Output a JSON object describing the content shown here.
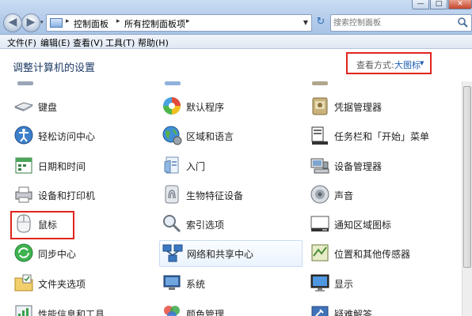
{
  "window": {
    "minimize_glyph": "—",
    "maximize_glyph": "□",
    "close_glyph": "✕"
  },
  "nav": {
    "back_glyph": "◀",
    "forward_glyph": "▶"
  },
  "address": {
    "crumbs": [
      "控制面板",
      "所有控制面板项"
    ],
    "refresh_glyph": "↻"
  },
  "search": {
    "placeholder": "搜索控制面板"
  },
  "menu": {
    "items": [
      "文件(F)",
      "编辑(E)",
      "查看(V)",
      "工具(T)",
      "帮助(H)"
    ]
  },
  "header": {
    "title": "调整计算机的设置",
    "view_by_label": "查看方式:",
    "view_by_value": "大图标"
  },
  "items": [
    {
      "label": "键盘",
      "icon": "keyboard-icon"
    },
    {
      "label": "默认程序",
      "icon": "default-programs-icon"
    },
    {
      "label": "凭据管理器",
      "icon": "credential-manager-icon"
    },
    {
      "label": "轻松访问中心",
      "icon": "ease-of-access-icon"
    },
    {
      "label": "区域和语言",
      "icon": "region-language-icon"
    },
    {
      "label": "任务栏和「开始」菜单",
      "icon": "taskbar-start-menu-icon"
    },
    {
      "label": "日期和时间",
      "icon": "date-time-icon"
    },
    {
      "label": "入门",
      "icon": "getting-started-icon"
    },
    {
      "label": "设备管理器",
      "icon": "device-manager-icon"
    },
    {
      "label": "设备和打印机",
      "icon": "devices-printers-icon"
    },
    {
      "label": "生物特征设备",
      "icon": "biometric-devices-icon"
    },
    {
      "label": "声音",
      "icon": "sound-icon"
    },
    {
      "label": "鼠标",
      "icon": "mouse-icon"
    },
    {
      "label": "索引选项",
      "icon": "indexing-options-icon"
    },
    {
      "label": "通知区域图标",
      "icon": "notification-area-icon"
    },
    {
      "label": "同步中心",
      "icon": "sync-center-icon"
    },
    {
      "label": "网络和共享中心",
      "icon": "network-sharing-icon"
    },
    {
      "label": "位置和其他传感器",
      "icon": "location-sensors-icon"
    },
    {
      "label": "文件夹选项",
      "icon": "folder-options-icon"
    },
    {
      "label": "系统",
      "icon": "system-icon"
    },
    {
      "label": "显示",
      "icon": "display-icon"
    },
    {
      "label": "性能信息和工具",
      "icon": "performance-icon"
    },
    {
      "label": "颜色管理",
      "icon": "color-management-icon"
    },
    {
      "label": "疑难解答",
      "icon": "troubleshooting-icon"
    }
  ]
}
